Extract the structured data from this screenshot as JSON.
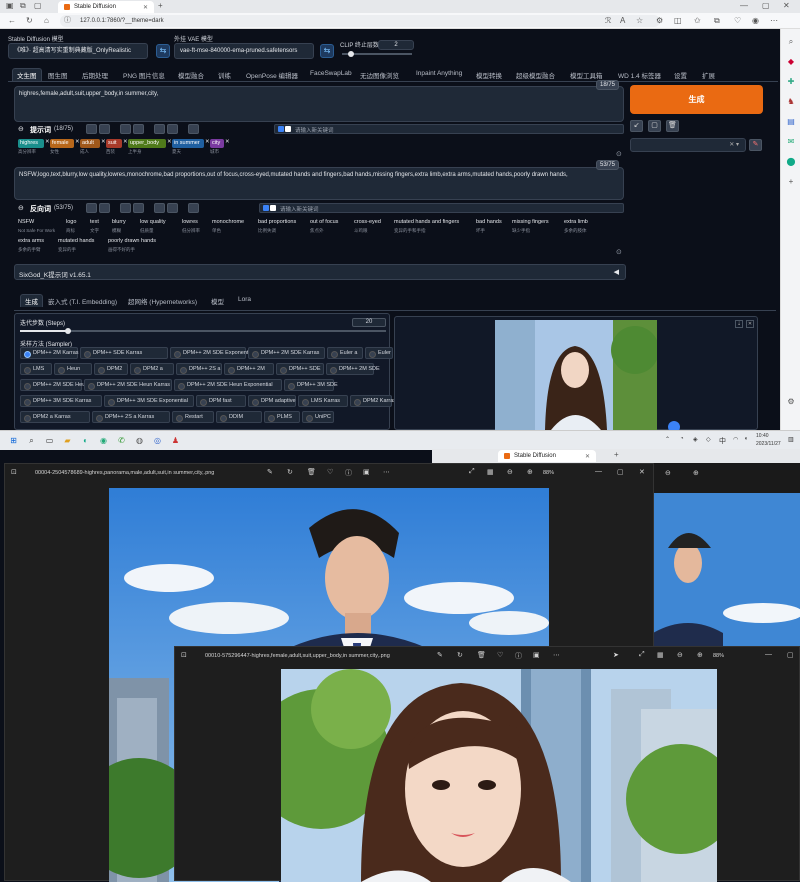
{
  "browser": {
    "tab_title": "Stable Diffusion",
    "url": "127.0.0.1:7860/?__theme=dark"
  },
  "sd": {
    "model_label": "Stable Diffusion 模型",
    "model_value": "《唯》· 超高清写实重制典藏版_OnlyRealistic",
    "vae_label": "外挂 VAE 模型",
    "vae_value": "vae-ft-mse-840000-ema-pruned.safetensors",
    "clip_label": "CLIP 终止层数",
    "clip_value": "2",
    "tabs": [
      "文生图",
      "图生图",
      "后期处理",
      "PNG 图片信息",
      "模型融合",
      "训练",
      "OpenPose 编辑器",
      "FaceSwapLab",
      "无边图像浏览",
      "Inpaint Anything",
      "模型转换",
      "超级模型融合",
      "模型工具箱",
      "WD 1.4 标签器",
      "设置",
      "扩展"
    ],
    "positive_prompt": "highres,female,adult,suit,upper_body,in summer,city,",
    "positive_counter": "18/75",
    "positive_label": "提示词",
    "positive_count": "(18/75)",
    "keyword_placeholder": "请输入新关键词",
    "positive_tags": [
      {
        "text": "highres",
        "sub": "高分辨率",
        "color": "#1a8f8c"
      },
      {
        "text": "female",
        "sub": "女性",
        "color": "#b8671a"
      },
      {
        "text": "adult",
        "sub": "成人",
        "color": "#a0581a"
      },
      {
        "text": "suit",
        "sub": "西装",
        "color": "#a83a2a"
      },
      {
        "text": "upper_body",
        "sub": "上半身",
        "color": "#4f7a1a"
      },
      {
        "text": "in summer",
        "sub": "夏天",
        "color": "#1f5fa0"
      },
      {
        "text": "city",
        "sub": "城市",
        "color": "#7a3aa0"
      }
    ],
    "negative_prompt": "NSFW,logo,text,blurry,low quality,lowres,monochrome,bad proportions,out of focus,cross-eyed,mutated hands and fingers,bad hands,missing fingers,extra limb,extra arms,mutated hands,poorly drawn hands,",
    "negative_counter": "53/75",
    "negative_label": "反向词",
    "negative_count": "(53/75)",
    "negative_tags_row1": [
      {
        "text": "NSFW",
        "sub": "Not Safe For Work"
      },
      {
        "text": "logo",
        "sub": "商标"
      },
      {
        "text": "text",
        "sub": "文字"
      },
      {
        "text": "blurry",
        "sub": "模糊"
      },
      {
        "text": "low quality",
        "sub": "低质量"
      },
      {
        "text": "lowres",
        "sub": "低分辨率"
      },
      {
        "text": "monochrome",
        "sub": "单色"
      },
      {
        "text": "bad proportions",
        "sub": "比例失调"
      },
      {
        "text": "out of focus",
        "sub": "焦点外"
      },
      {
        "text": "cross-eyed",
        "sub": "斗鸡眼"
      },
      {
        "text": "mutated hands and fingers",
        "sub": "变异的手和手指"
      },
      {
        "text": "bad hands",
        "sub": "坏手"
      },
      {
        "text": "missing fingers",
        "sub": "缺少手指"
      },
      {
        "text": "extra limb",
        "sub": "多余的肢体"
      }
    ],
    "negative_tags_row2": [
      {
        "text": "extra arms",
        "sub": "多余的手臂"
      },
      {
        "text": "mutated hands",
        "sub": "变异的手"
      },
      {
        "text": "poorly drawn hands",
        "sub": "画得不好的手"
      }
    ],
    "plugin_title": "SixGod_K提示词 v1.65.1",
    "generate_label": "生成",
    "subtabs": [
      "生成",
      "嵌入式 (T.I. Embedding)",
      "超网络 (Hypernetworks)",
      "模型",
      "Lora"
    ],
    "steps_label": "迭代步数 (Steps)",
    "steps_value": "20",
    "steps_fraction": 0.13,
    "sampler_label": "采样方法 (Sampler)",
    "samplers": [
      "DPM++ 2M Karras",
      "DPM++ SDE Karras",
      "DPM++ 2M SDE Exponential",
      "DPM++ 2M SDE Karras",
      "Euler a",
      "Euler",
      "LMS",
      "Heun",
      "DPM2",
      "DPM2 a",
      "DPM++ 2S a",
      "DPM++ 2M",
      "DPM++ SDE",
      "DPM++ 2M SDE",
      "DPM++ 2M SDE Heun",
      "DPM++ 2M SDE Heun Karras",
      "DPM++ 2M SDE Heun Exponential",
      "DPM++ 3M SDE",
      "DPM++ 3M SDE Karras",
      "DPM++ 3M SDE Exponential",
      "DPM fast",
      "DPM adaptive",
      "LMS Karras",
      "DPM2 Karras",
      "DPM2 a Karras",
      "DPM++ 2S a Karras",
      "Restart",
      "DDIM",
      "PLMS",
      "UniPC",
      "LCM"
    ]
  },
  "taskbar": {
    "time": "10:40",
    "date": "2023/11/27",
    "ime": "中",
    "tab_title": "Stable Diffusion"
  },
  "viewer1": {
    "filename": "00004-2504578689-highres,panorama,male,adult,suit,in summer,city,.png",
    "zoom": "88%"
  },
  "viewer2": {
    "filename": "00010-575296447-highres,female,adult,suit,upper_body,in summer,city,.png",
    "zoom": "88%"
  },
  "colors": {
    "accent_orange": "#ea6a12",
    "bg_dark": "#0b0f19",
    "panel": "#1f2937"
  }
}
